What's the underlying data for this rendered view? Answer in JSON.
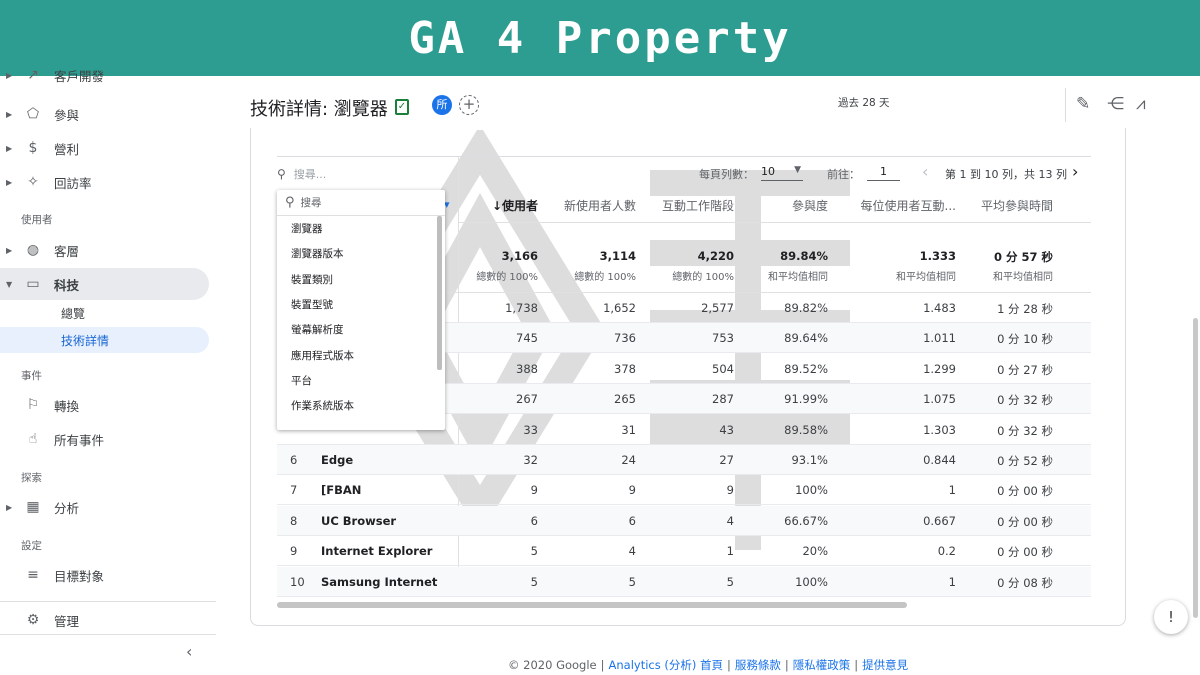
{
  "banner": {
    "title": "GA 4 Property"
  },
  "sidebar": {
    "top_partial": "客戶開發",
    "items": [
      {
        "label": "參與",
        "icon": "tag-icon"
      },
      {
        "label": "營利",
        "icon": "dollar-icon"
      },
      {
        "label": "回訪率",
        "icon": "retention-icon"
      }
    ],
    "section_users": "使用者",
    "users_items": [
      {
        "label": "客層",
        "icon": "globe-icon"
      },
      {
        "label": "科技",
        "icon": "devices-icon"
      }
    ],
    "tech_sub": [
      "總覽",
      "技術詳情"
    ],
    "section_events": "事件",
    "events_items": [
      {
        "label": "轉換",
        "icon": "flag-icon"
      },
      {
        "label": "所有事件",
        "icon": "touch-icon"
      }
    ],
    "section_explore": "探索",
    "explore_items": [
      {
        "label": "分析",
        "icon": "analysis-icon"
      }
    ],
    "section_settings": "設定",
    "settings_items": [
      {
        "label": "目標對象",
        "icon": "audience-icon"
      }
    ],
    "admin": {
      "label": "管理",
      "icon": "gear-icon"
    },
    "collapse_icon": "‹"
  },
  "header": {
    "title": "技術詳情: 瀏覽器",
    "avatar_label": "所",
    "date_range": "過去 28 天"
  },
  "table_controls": {
    "search_placeholder": "搜尋...",
    "rows_per_page_label": "每頁列數：",
    "rows_per_page_value": "10",
    "goto_label": "前往：",
    "goto_value": "1",
    "range_text": "第 1 到 10 列，共 13 列"
  },
  "columns": [
    "↓使用者",
    "新使用者人數",
    "互動工作階段",
    "參與度",
    "每位使用者互動...",
    "平均參與時間"
  ],
  "totals": {
    "values": [
      "3,166",
      "3,114",
      "4,220",
      "89.84%",
      "1.333",
      "0 分 57 秒"
    ],
    "subs": [
      "總數的 100%",
      "總數的 100%",
      "總數的 100%",
      "和平均值相同",
      "和平均值相同",
      "和平均值相同"
    ]
  },
  "rows": [
    {
      "idx": "",
      "name": "",
      "v": [
        "1,738",
        "1,652",
        "2,577",
        "89.82%",
        "1.483",
        "1 分 28 秒"
      ]
    },
    {
      "idx": "",
      "name": "",
      "v": [
        "745",
        "736",
        "753",
        "89.64%",
        "1.011",
        "0 分 10 秒"
      ]
    },
    {
      "idx": "",
      "name": "",
      "v": [
        "388",
        "378",
        "504",
        "89.52%",
        "1.299",
        "0 分 27 秒"
      ]
    },
    {
      "idx": "",
      "name": "",
      "v": [
        "267",
        "265",
        "287",
        "91.99%",
        "1.075",
        "0 分 32 秒"
      ]
    },
    {
      "idx": "",
      "name": "",
      "v": [
        "33",
        "31",
        "43",
        "89.58%",
        "1.303",
        "0 分 32 秒"
      ]
    },
    {
      "idx": "6",
      "name": "Edge",
      "v": [
        "32",
        "24",
        "27",
        "93.1%",
        "0.844",
        "0 分 52 秒"
      ]
    },
    {
      "idx": "7",
      "name": "[FBAN",
      "v": [
        "9",
        "9",
        "9",
        "100%",
        "1",
        "0 分 00 秒"
      ]
    },
    {
      "idx": "8",
      "name": "UC Browser",
      "v": [
        "6",
        "6",
        "4",
        "66.67%",
        "0.667",
        "0 分 00 秒"
      ]
    },
    {
      "idx": "9",
      "name": "Internet Explorer",
      "v": [
        "5",
        "4",
        "1",
        "20%",
        "0.2",
        "0 分 00 秒"
      ]
    },
    {
      "idx": "10",
      "name": "Samsung Internet",
      "v": [
        "5",
        "5",
        "5",
        "100%",
        "1",
        "0 分 08 秒"
      ]
    }
  ],
  "dropdown": {
    "search_placeholder": "搜尋",
    "items": [
      "瀏覽器",
      "瀏覽器版本",
      "裝置類別",
      "裝置型號",
      "螢幕解析度",
      "應用程式版本",
      "平台",
      "作業系統版本"
    ]
  },
  "footer": {
    "copyright": "© 2020 Google",
    "links": [
      "Analytics (分析) 首頁",
      "服務條款",
      "隱私權政策",
      "提供意見"
    ]
  }
}
